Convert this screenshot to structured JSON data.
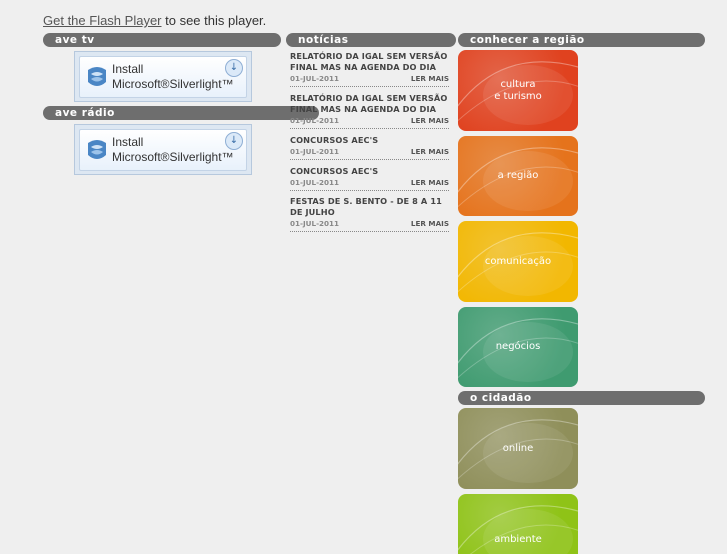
{
  "flash": {
    "link": "Get the Flash Player",
    "rest": " to see this player."
  },
  "headers": {
    "ave_tv": "ave tv",
    "ave_radio": "ave rádio",
    "noticias": "notícias",
    "conhecer": "conhecer a região",
    "cidadao": "o cidadão"
  },
  "silverlight": {
    "line1": "Install",
    "line2": "Microsoft®Silverlight™"
  },
  "news": [
    {
      "title": "RELATÓRIO DA IGAL SEM VERSÃO FINAL MAS NA AGENDA DO DIA",
      "date": "01-JUL-2011",
      "more": "LER MAIS"
    },
    {
      "title": "RELATÓRIO DA IGAL SEM VERSÃO FINAL MAS NA AGENDA DO DIA",
      "date": "01-JUL-2011",
      "more": "LER MAIS"
    },
    {
      "title": "CONCURSOS AEC'S",
      "date": "01-JUL-2011",
      "more": "LER MAIS"
    },
    {
      "title": "CONCURSOS AEC'S",
      "date": "01-JUL-2011",
      "more": "LER MAIS"
    },
    {
      "title": "FESTAS DE S. BENTO - DE 8 A 11 DE JULHO",
      "date": "01-JUL-2011",
      "more": "LER MAIS"
    }
  ],
  "tiles": {
    "cultura": {
      "label": "cultura\ne turismo",
      "color": "#e0421f"
    },
    "regiao": {
      "label": "a região",
      "color": "#e5731c"
    },
    "comunicacao": {
      "label": "comunicação",
      "color": "#f2b700"
    },
    "negocios": {
      "label": "negócios",
      "color": "#3f9b70"
    },
    "online": {
      "label": "online",
      "color": "#8f8f5a"
    },
    "ambiente": {
      "label": "ambiente",
      "color": "#8fc317"
    }
  }
}
